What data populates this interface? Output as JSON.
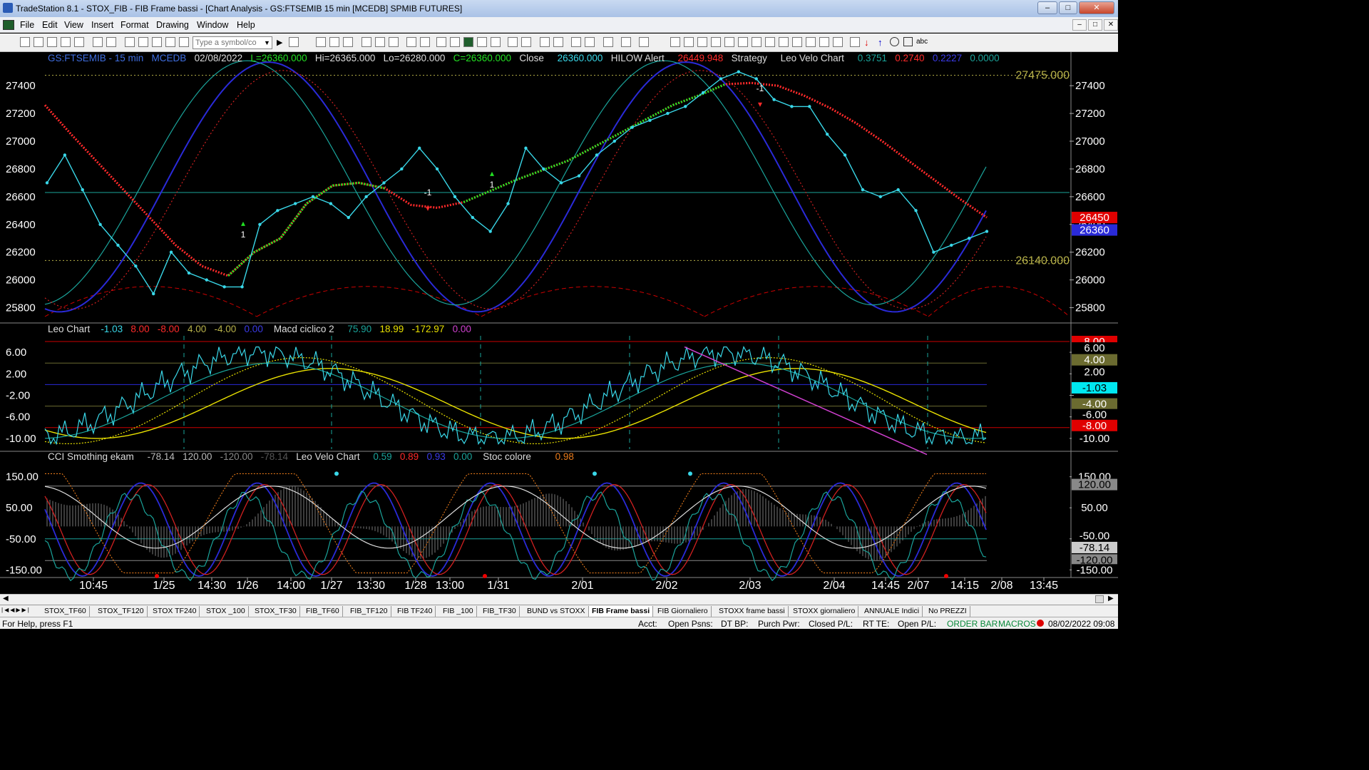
{
  "window": {
    "title": "TradeStation 8.1 - STOX_FIB - FIB Frame bassi - [Chart Analysis - GS:FTSEMIB  15 min  [MCEDB] SPMIB FUTURES]"
  },
  "menu": [
    "File",
    "Edit",
    "View",
    "Insert",
    "Format",
    "Drawing",
    "Window",
    "Help"
  ],
  "toolbar": {
    "symbol_placeholder": "Type a symbol/co",
    "abc": "abc"
  },
  "header": {
    "symbol": "GS:FTSEMIB - 15 min",
    "feed": "MCEDB",
    "date": "02/08/2022",
    "last": "L=26360.000",
    "hi": "Hi=26365.000",
    "lo": "Lo=26280.000",
    "close": "C=26360.000",
    "close_label": "Close",
    "close_val": "26360.000",
    "hilow": "HILOW Alert",
    "hilow_val": "26449.948",
    "strategy": "Strategy",
    "leo": "Leo Velo Chart",
    "leo_v1": "0.3751",
    "leo_v2": "0.2740",
    "leo_v3": "0.2227",
    "leo_v4": "0.0000"
  },
  "pane2_header": {
    "name": "Leo Chart",
    "v1": "-1.03",
    "v2": "8.00",
    "v3": "-8.00",
    "v4": "4.00",
    "v5": "-4.00",
    "v6": "0.00",
    "macd": "Macd ciclico 2",
    "m1": "75.90",
    "m2": "18.99",
    "m3": "-172.97",
    "m4": "0.00"
  },
  "pane3_header": {
    "name": "CCI Smothing ekam",
    "v1": "-78.14",
    "v2": "120.00",
    "v3": "-120.00",
    "v4": "-78.14",
    "leo": "Leo Velo Chart",
    "l1": "0.59",
    "l2": "0.89",
    "l3": "0.93",
    "l4": "0.00",
    "stoc": "Stoc colore",
    "s1": "0.98"
  },
  "price_axis": [
    "27400",
    "27200",
    "27000",
    "26800",
    "26600",
    "26400",
    "26200",
    "26000",
    "25800"
  ],
  "price_marks": {
    "upper": "27475.000",
    "lower": "26140.000",
    "hilow_tag": "26450",
    "last_tag": "26360"
  },
  "pane2_axis": [
    "6.00",
    "2.00",
    "-2.00",
    "-6.00",
    "-10.00"
  ],
  "pane2_tags": [
    "8.00",
    "6.00",
    "4.00",
    "2.00",
    "-1.03",
    "-4.00",
    "-6.00",
    "-8.00",
    "-10.00"
  ],
  "pane3_axis": [
    "150.00",
    "50.00",
    "-50.00",
    "-150.00"
  ],
  "pane3_tags": [
    "150.00",
    "120.00",
    "50.00",
    "-50.00",
    "-78.14",
    "-120.00",
    "-150.00"
  ],
  "time_axis": [
    "10:45",
    "1/25",
    "14:30",
    "1/26",
    "14:00",
    "1/27",
    "13:30",
    "1/28",
    "13:00",
    "1/31",
    "2/01",
    "2/02",
    "2/03",
    "2/04",
    "14:45",
    "2/07",
    "14:15",
    "2/08",
    "13:45"
  ],
  "signals": {
    "buy": "1",
    "sell": "-1"
  },
  "tabs": [
    "STOX_TF60",
    "STOX_TF120",
    "STOX TF240",
    "STOX _100",
    "STOX_TF30",
    "FIB_TF60",
    "FIB_TF120",
    "FIB TF240",
    "FIB _100",
    "FIB_TF30",
    "BUND vs STOXX",
    "FIB Frame bassi",
    "FIB Giornaliero",
    "STOXX frame bassi",
    "STOXX giornaliero",
    "ANNUALE Indici",
    "No PREZZI"
  ],
  "active_tab": "FIB Frame bassi",
  "status": {
    "help": "For Help, press F1",
    "acct": "Acct:",
    "open_psns": "Open Psns:",
    "dt_bp": "DT BP:",
    "purch_pwr": "Purch Pwr:",
    "closed_pl": "Closed P/L:",
    "rt_te": "RT TE:",
    "open_pl": "Open P/L:",
    "order_bar": "ORDER BAR",
    "macros": "MACROS",
    "datetime": "08/02/2022 09:08"
  },
  "colors": {
    "cyan": "#39d7e8",
    "red": "#ff2a2a",
    "green": "#22e022",
    "blue": "#2a2ad8",
    "teal": "#1aa39a",
    "yellow": "#e8e000",
    "olive": "#b8b24a",
    "magenta": "#d040d0"
  },
  "chart_data": {
    "type": "line",
    "title": "GS:FTSEMIB - 15 min",
    "ylim": [
      25700,
      27550
    ],
    "series": [
      {
        "name": "Close",
        "values": [
          26700,
          26900,
          26650,
          26400,
          26250,
          26100,
          25900,
          26200,
          26050,
          26000,
          25950,
          25950,
          26400,
          26500,
          26550,
          26600,
          26550,
          26450,
          26600,
          26700,
          26800,
          26950,
          26800,
          26600,
          26450,
          26350,
          26550,
          26950,
          26800,
          26700,
          26750,
          26900,
          27000,
          27100,
          27150,
          27200,
          27250,
          27350,
          27450,
          27500,
          27450,
          27300,
          27250,
          27250,
          27050,
          26900,
          26650,
          26600,
          26650,
          26500,
          26200,
          26250,
          26300,
          26350
        ]
      },
      {
        "name": "HILOW Alert",
        "values": [
          27260,
          27050,
          26850,
          26650,
          26450,
          26250,
          26100,
          26030,
          26200,
          26300,
          26550,
          26680,
          26700,
          26660,
          26540,
          26520,
          26560,
          26640,
          26720,
          26790,
          26860,
          26960,
          27060,
          27160,
          27260,
          27330,
          27410,
          27420,
          27400,
          27330,
          27240,
          27130,
          27000,
          26860,
          26720,
          26580,
          26450
        ]
      }
    ],
    "markers": [
      "1",
      "-1",
      "-1",
      "1",
      "-1"
    ]
  }
}
